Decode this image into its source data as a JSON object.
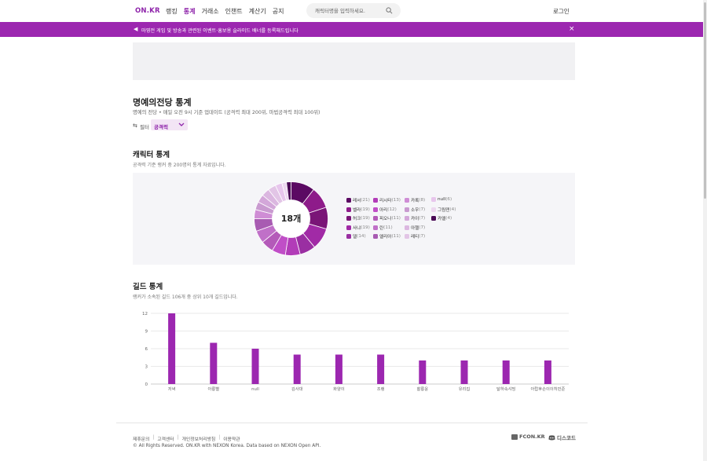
{
  "header": {
    "logo": "ON.KR",
    "nav": [
      {
        "label": "랭킹",
        "active": false
      },
      {
        "label": "통계",
        "active": true
      },
      {
        "label": "거래소",
        "active": false
      },
      {
        "label": "인챈트",
        "active": false
      },
      {
        "label": "계산기",
        "active": false
      },
      {
        "label": "공지",
        "active": false
      }
    ],
    "search_placeholder": "캐릭터명을 입력하세요.",
    "search_icon": "search-icon",
    "login": "로그인"
  },
  "banner": {
    "icon": "megaphone-icon",
    "text": "마영전 게임 및 방송과 관련된 이벤트·홍보용 슬라이드 배너를 등록해드립니다",
    "close": "×"
  },
  "hall_of_fame": {
    "title": "명예의전당 통계",
    "subtitle": "명예의 전당 • 매일 오전 9시 기준 업데이트 (공격력 최대 200위, 마법공격력 최대 100위)",
    "filter_label": "필터",
    "filter_value": "공격력"
  },
  "character_stats": {
    "title": "캐릭터 통계",
    "subtitle": "공격력 기준 랭커 중 200명의 통계 자료입니다.",
    "center_label": "18개"
  },
  "guild_stats": {
    "title": "길드 통계",
    "subtitle": "랭커가 소속된 길드 106개 중 상위 10개 길드입니다."
  },
  "chart_data": [
    {
      "type": "pie",
      "title": "",
      "categories": [
        "레서",
        "벨라",
        "허크",
        "사냐",
        "델",
        "리시타",
        "아리",
        "피오나",
        "린",
        "엘리아",
        "카록",
        "소우",
        "카이",
        "아첼",
        "레티",
        "null",
        "그림덴",
        "카엘"
      ],
      "values": [
        21,
        19,
        19,
        19,
        14,
        13,
        12,
        11,
        11,
        11,
        8,
        7,
        7,
        7,
        7,
        6,
        4,
        4
      ],
      "colors": [
        "#5b0a63",
        "#8e1b8a",
        "#7a1577",
        "#a12aa6",
        "#9a2fa2",
        "#b23cb8",
        "#c04ec7",
        "#b45ab9",
        "#c070c8",
        "#a85bb2",
        "#cf8dd5",
        "#c99ad0",
        "#d3a7d9",
        "#dbb7e0",
        "#e2c5e6",
        "#e7c6ec",
        "#ecd7ef",
        "#4a0a55"
      ]
    },
    {
      "type": "bar",
      "title": "",
      "categories": [
        "저녁",
        "아롱별",
        "null",
        "김사대",
        "화양이",
        "조랭",
        "찰롱윤",
        "유리집",
        "달하속샤밍",
        "아랍후손이이히민준"
      ],
      "values": [
        12,
        7,
        6,
        5,
        5,
        5,
        4,
        4,
        4,
        4
      ],
      "ylim": [
        0,
        12
      ],
      "yticks": [
        "0",
        "3",
        "6",
        "9",
        "12"
      ],
      "color": "#9c27b0",
      "grid": true
    }
  ],
  "footer": {
    "links": [
      "제휴문의",
      "고객센터",
      "개인정보처리방침",
      "이용약관"
    ],
    "copyright": "© All Rights Reserved. ON.KR with NEXON Korea. Data based on NEXON Open API.",
    "fcon": "FCON.KR",
    "discord": "디스코드"
  }
}
